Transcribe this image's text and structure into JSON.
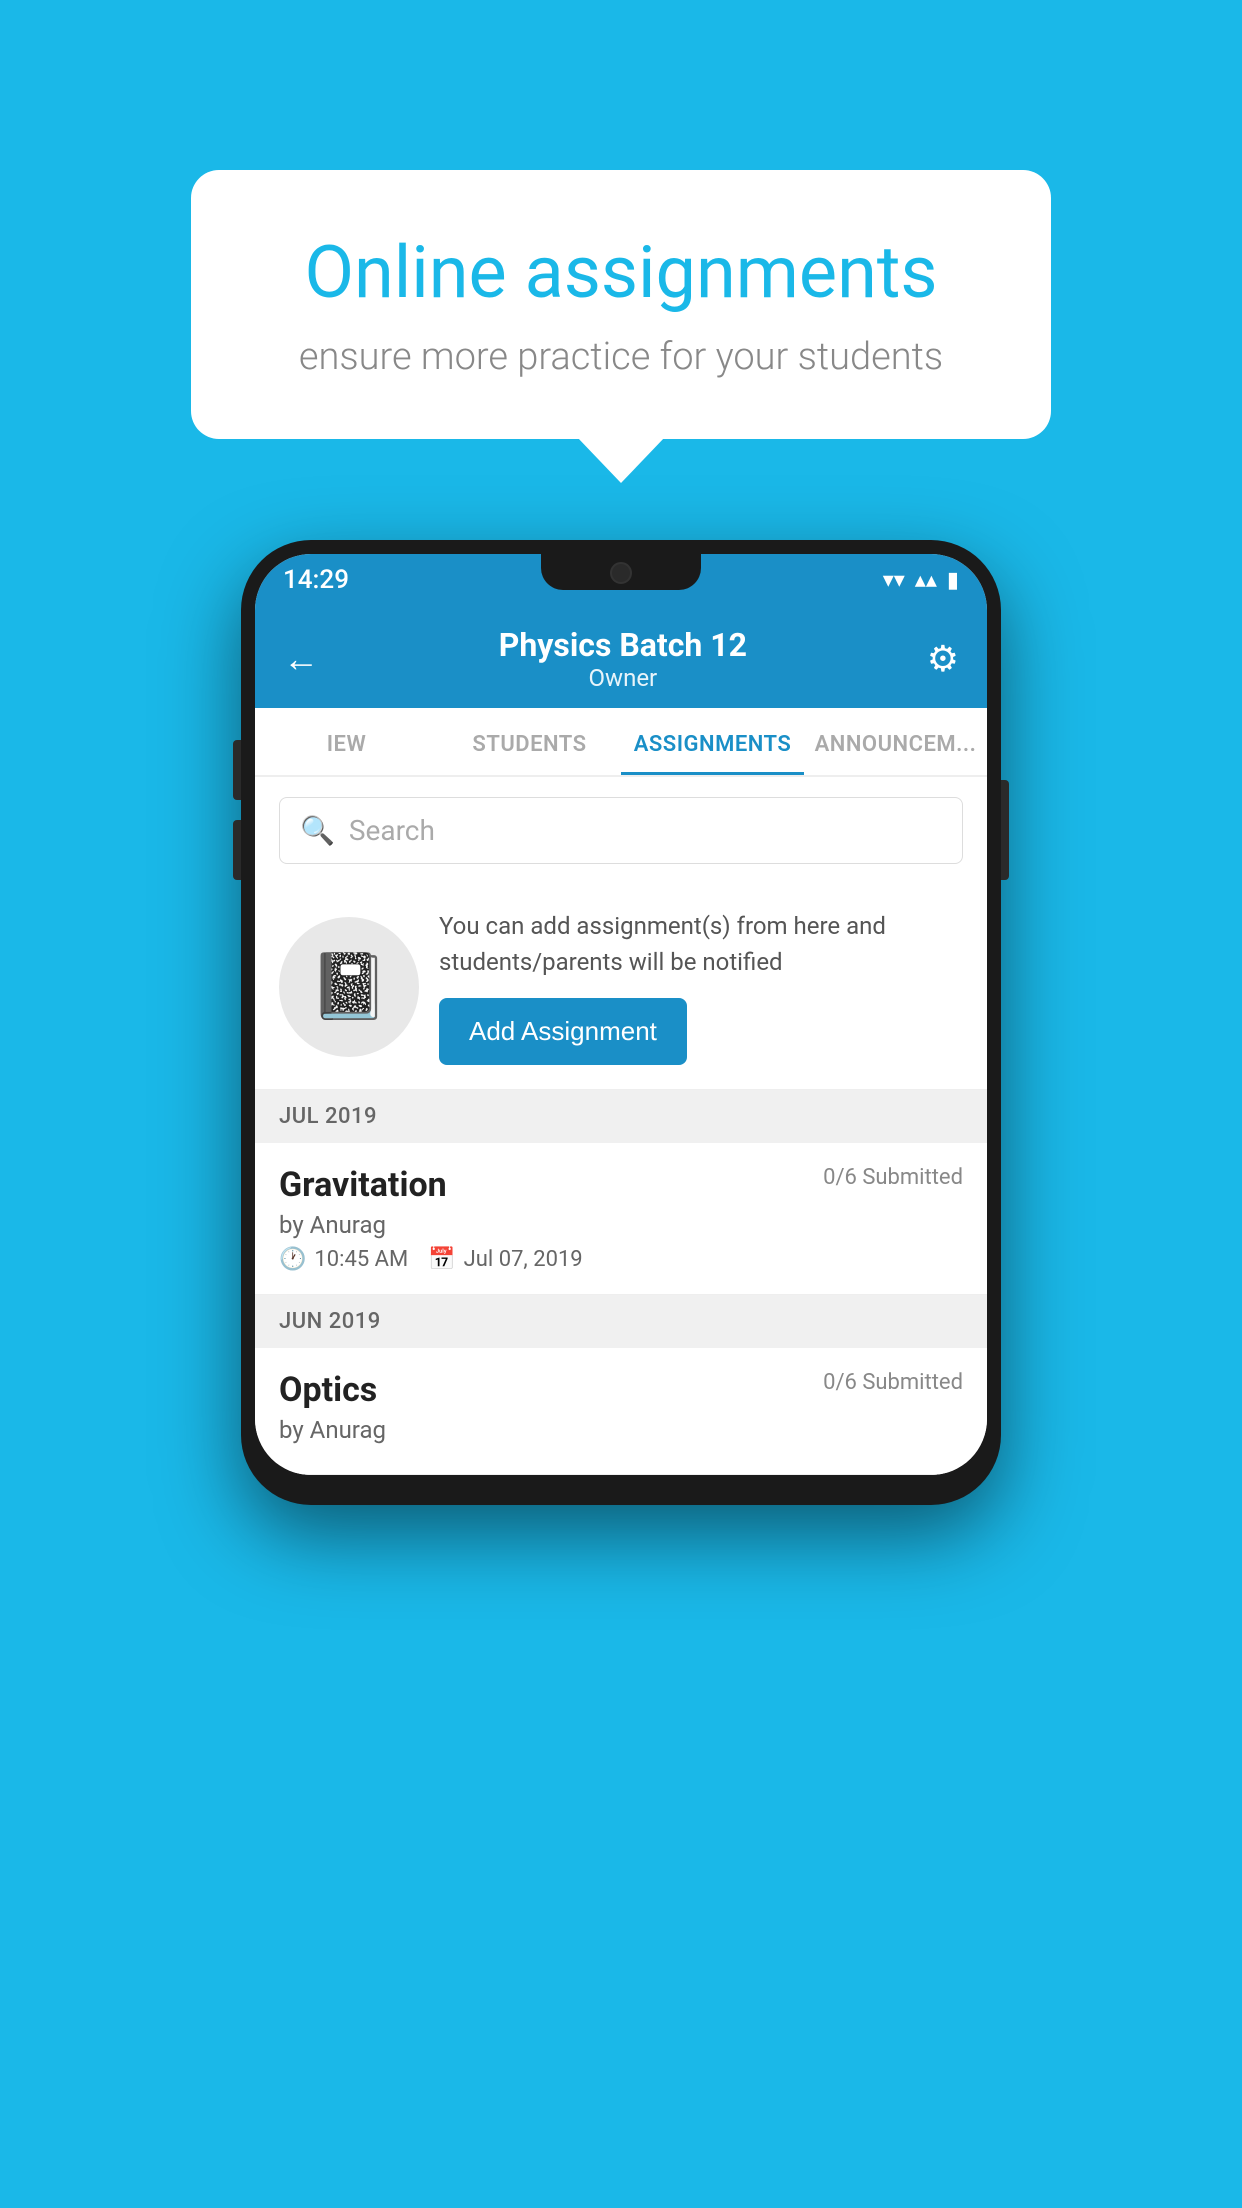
{
  "background_color": "#1ab8e8",
  "speech_bubble": {
    "title": "Online assignments",
    "subtitle": "ensure more practice for your students"
  },
  "status_bar": {
    "time": "14:29",
    "wifi": "▾",
    "signal": "▴▴",
    "battery": "▮"
  },
  "header": {
    "title": "Physics Batch 12",
    "subtitle": "Owner",
    "back_label": "←",
    "settings_label": "⚙"
  },
  "tabs": [
    {
      "id": "iew",
      "label": "IEW",
      "active": false
    },
    {
      "id": "students",
      "label": "STUDENTS",
      "active": false
    },
    {
      "id": "assignments",
      "label": "ASSIGNMENTS",
      "active": true
    },
    {
      "id": "announcements",
      "label": "ANNOUNCEM...",
      "active": false
    }
  ],
  "search": {
    "placeholder": "Search"
  },
  "promo": {
    "description": "You can add assignment(s) from here and students/parents will be notified",
    "button_label": "Add Assignment"
  },
  "sections": [
    {
      "month": "JUL 2019",
      "assignments": [
        {
          "title": "Gravitation",
          "submitted": "0/6 Submitted",
          "by": "by Anurag",
          "time": "10:45 AM",
          "date": "Jul 07, 2019"
        }
      ]
    },
    {
      "month": "JUN 2019",
      "assignments": [
        {
          "title": "Optics",
          "submitted": "0/6 Submitted",
          "by": "by Anurag",
          "time": "",
          "date": ""
        }
      ]
    }
  ]
}
